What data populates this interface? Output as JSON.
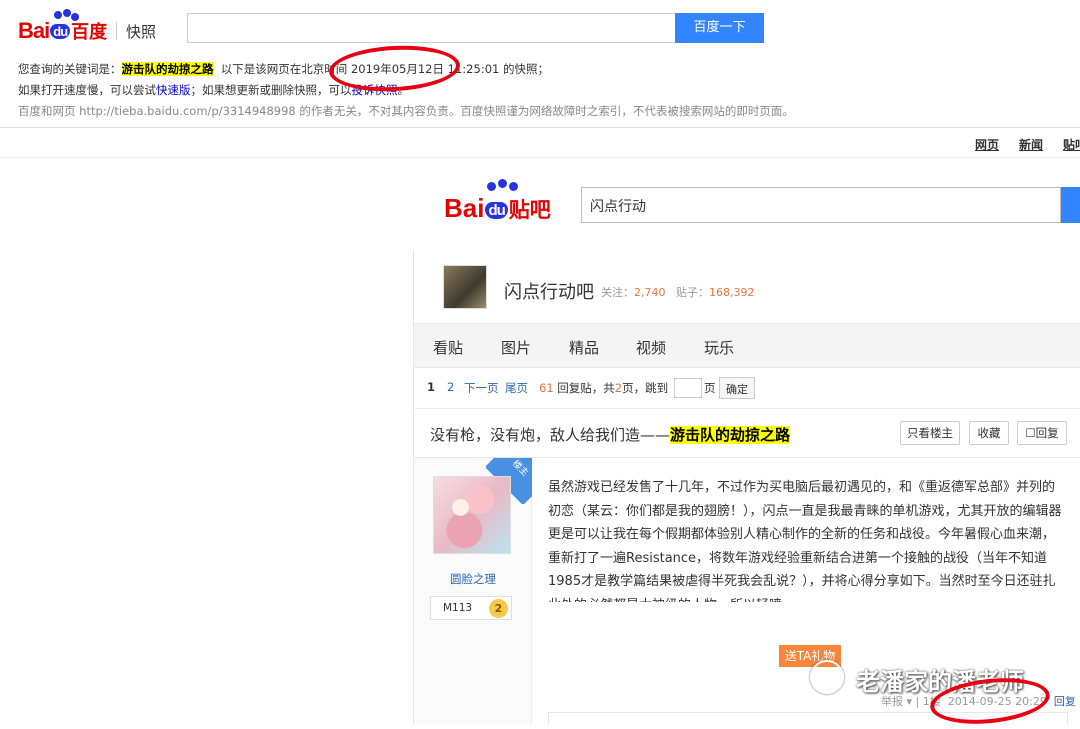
{
  "snapshot": {
    "logo_bai": "Bai",
    "logo_du": "du",
    "logo_cn": "百度",
    "logo_section": "快照",
    "search_button": "百度一下",
    "line1_prefix": "您查询的关键词是：",
    "keyword": "游击队的劫掠之路",
    "line1_mid": "以下是该网页在北京时间",
    "line1_date": "2019年05月12日",
    "line1_time": "11:25:01",
    "line1_suffix": "的快照；",
    "line2_prefix": "如果打开速度慢，可以尝试",
    "line2_link1": "快速版",
    "line2_mid": "；如果想更新或删除快照，可以",
    "line2_link2": "投诉快照",
    "line2_suffix": "。",
    "line3_prefix": "百度和网页",
    "line3_url": "http://tieba.baidu.com/p/3314948998",
    "line3_suffix": "的作者无关，不对其内容负责。百度快照谨为网络故障时之索引，不代表被搜索网站的即时页面。"
  },
  "topnav": {
    "item1": "网页",
    "item2": "新闻",
    "item3": "贴吧"
  },
  "tieba": {
    "logo_bai": "Bai",
    "logo_du": "du",
    "logo_cn": "贴吧",
    "search_value": "闪点行动"
  },
  "forum": {
    "name": "闪点行动吧",
    "follow_label": "关注：",
    "follow_count": "2,740",
    "posts_label": "贴子：",
    "posts_count": "168,392",
    "tabs": [
      "看贴",
      "图片",
      "精品",
      "视频",
      "玩乐"
    ]
  },
  "pager": {
    "current": "1",
    "page2": "2",
    "next": "下一页",
    "last": "尾页",
    "reply_count": "61",
    "reply_label": "回复贴，共",
    "pages": "2",
    "pages_suffix": "页，跳到",
    "page_unit": "页",
    "ok": "确定"
  },
  "thread": {
    "title_prefix": "没有枪，没有炮，敌人给我们造——",
    "title_keyword": "游击队的劫掠之路",
    "btn_owner": "只看楼主",
    "btn_collect": "收藏",
    "btn_reply": "回复"
  },
  "post": {
    "badge": "楼主",
    "author": "圆脸之理",
    "level_name": "M113",
    "level": "2",
    "body": "虽然游戏已经发售了十几年，不过作为买电脑后最初遇见的，和《重返德军总部》并列的初恋（某云：你们都是我的翅膀！），闪点一直是我最青睐的单机游戏，尤其开放的编辑器更是可以让我在每个假期都体验别人精心制作的全新的任务和战役。今年暑假心血来潮，重新打了一遍Resistance，将数年游戏经验重新结合进第一个接触的战役（当年不知道1985才是教学篇结果被虐得半死我会乱说？），并将心得分享如下。当然时至今日还驻扎此处的必然都是大神级的人物，所以轻喷。",
    "gift": "送TA礼物",
    "report": "举报",
    "floor": "1楼",
    "timestamp": "2014-09-25 20:29",
    "reply": "回复"
  },
  "watermark": {
    "text": "老潘家的潘老师"
  },
  "colors": {
    "accent": "#3385ff",
    "brand_red": "#e10602",
    "highlight": "#ffff00",
    "annotation": "#e60012"
  }
}
